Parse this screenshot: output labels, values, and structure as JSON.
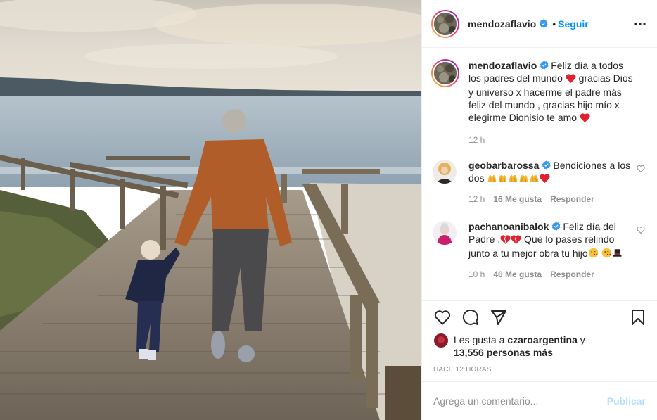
{
  "post": {
    "username": "mendozaflavio",
    "dot": "•",
    "follow_label": "Seguir",
    "caption": "Feliz día a todos los padres del mundo ❤️ gracias Dios y universo x hacerme el padre más feliz del mundo , gracias hijo mío x elegirme Dionisio te amo ❤️",
    "caption_parts": [
      "Feliz día a todos los padres del mundo ",
      " gracias Dios y universo x hacerme el padre más feliz del mundo , gracias hijo mío x elegirme Dionisio te amo "
    ],
    "caption_time": "12 h"
  },
  "comments": [
    {
      "username": "geobarbarossa",
      "text": "Bendiciones a los dos",
      "emojis": [
        "🙌",
        "🙌",
        "🙌",
        "🙌",
        "🙌",
        "❤️"
      ],
      "time": "12 h",
      "likes": "16 Me gusta",
      "reply": "Responder"
    },
    {
      "username": "pachanoanibalok",
      "text_a": "Feliz día del Padre .",
      "text_b": " Qué lo pases relindo junto a tu mejor obra tu hijo",
      "emojis_a": [
        "❤️",
        "❤️"
      ],
      "emojis_b": [
        "😘",
        "🎩"
      ],
      "time": "10 h",
      "likes": "46 Me gusta",
      "reply": "Responder"
    }
  ],
  "likes": {
    "prefix": "Les gusta a ",
    "user": "czaroargentina",
    "mid": " y",
    "count": "13,556 personas más"
  },
  "timestamp": "HACE 12 HORAS",
  "add_comment": {
    "placeholder": "Agrega un comentario...",
    "publish_label": "Publicar"
  },
  "icons": {
    "verified": "verified-badge-icon",
    "more": "more-options-icon",
    "like": "heart-icon",
    "comment": "comment-icon",
    "share": "share-icon",
    "save": "bookmark-icon"
  },
  "colors": {
    "accent": "#0095f6",
    "publish_disabled": "#b2dffc",
    "muted": "#8e8e8e",
    "heart": "#ed4956"
  }
}
